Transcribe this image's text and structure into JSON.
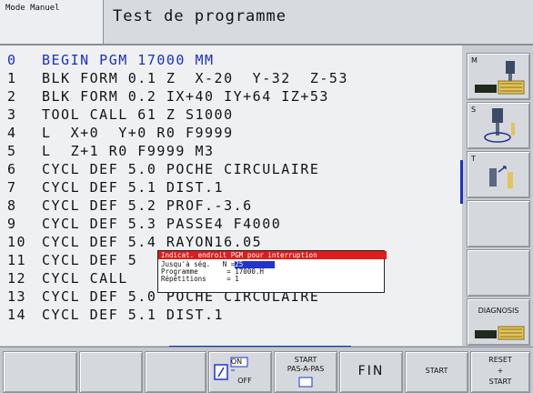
{
  "header": {
    "mode_label": "Mode Manuel",
    "title": "Test de programme"
  },
  "program_lines": [
    {
      "num": "0",
      "text": "BEGIN PGM 17000 MM",
      "highlight": true
    },
    {
      "num": "1",
      "text": "BLK FORM 0.1 Z  X-20  Y-32  Z-53",
      "highlight": false
    },
    {
      "num": "2",
      "text": "BLK FORM 0.2 IX+40 IY+64 IZ+53",
      "highlight": false
    },
    {
      "num": "3",
      "text": "TOOL CALL 61 Z S1000",
      "highlight": false
    },
    {
      "num": "4",
      "text": "L  X+0  Y+0 R0 F9999",
      "highlight": false
    },
    {
      "num": "5",
      "text": "L  Z+1 R0 F9999 M3",
      "highlight": false
    },
    {
      "num": "6",
      "text": "CYCL DEF 5.0 POCHE CIRCULAIRE",
      "highlight": false
    },
    {
      "num": "7",
      "text": "CYCL DEF 5.1 DIST.1",
      "highlight": false
    },
    {
      "num": "8",
      "text": "CYCL DEF 5.2 PROF.-3.6",
      "highlight": false
    },
    {
      "num": "9",
      "text": "CYCL DEF 5.3 PASSE4 F4000",
      "highlight": false
    },
    {
      "num": "10",
      "text": "CYCL DEF 5.4 RAYON16.05",
      "highlight": false
    },
    {
      "num": "11",
      "text": "CYCL DEF 5",
      "highlight": false
    },
    {
      "num": "12",
      "text": "CYCL CALL",
      "highlight": false
    },
    {
      "num": "13",
      "text": "CYCL DEF 5.0 POCHE CIRCULAIRE",
      "highlight": false
    },
    {
      "num": "14",
      "text": "CYCL DEF 5.1 DIST.1",
      "highlight": false
    }
  ],
  "popup": {
    "header": "Indicat. endroit PGM pour interruption",
    "rows": [
      {
        "label": "Jusqu'à séq.   N =",
        "value": "25"
      },
      {
        "label": "Programme       = ",
        "value": "17000.H"
      },
      {
        "label": "Répétitions     = ",
        "value": "1"
      }
    ]
  },
  "right_softkeys": {
    "m_label": "M",
    "s_label": "S",
    "t_label": "T",
    "diagnosis_label": "DIAGNOSIS"
  },
  "bottom_softkeys": {
    "on_label": "ON",
    "off_label": "OFF",
    "start_step_line1": "START",
    "start_step_line2": "PAS-A-PAS",
    "fin_label": "FIN",
    "start_label": "START",
    "reset_line1": "RESET",
    "reset_line2": "+",
    "reset_line3": "START"
  },
  "colors": {
    "highlight_text": "#1b2fc8",
    "popup_header": "#e01c1c",
    "input_field": "#1e35d0",
    "screen_bg": "#eef0f2"
  }
}
